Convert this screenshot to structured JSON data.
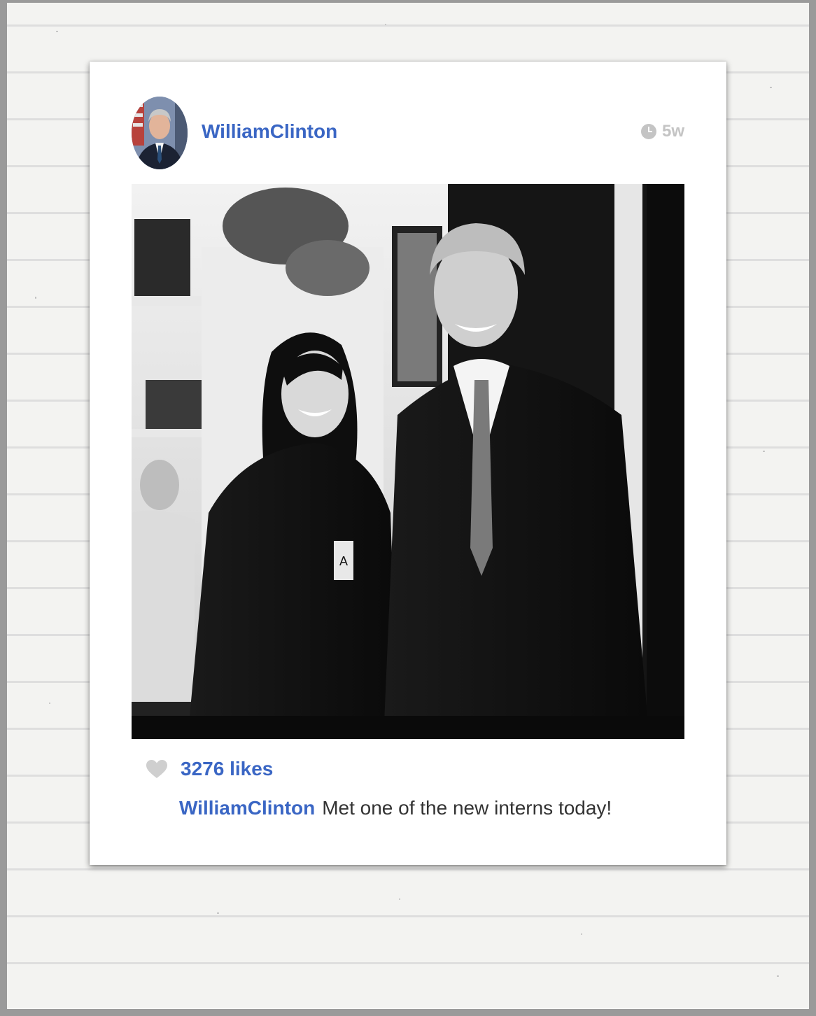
{
  "post": {
    "username": "WilliamClinton",
    "time_ago": "5w",
    "likes": "3276 likes",
    "caption_user": "WilliamClinton",
    "caption_text": "Met one of the new interns today!"
  },
  "colors": {
    "link_blue": "#3a66c4",
    "muted_gray": "#c4c4c4",
    "caption_text": "#333333"
  },
  "icons": {
    "time": "clock-icon",
    "like": "heart-icon"
  }
}
